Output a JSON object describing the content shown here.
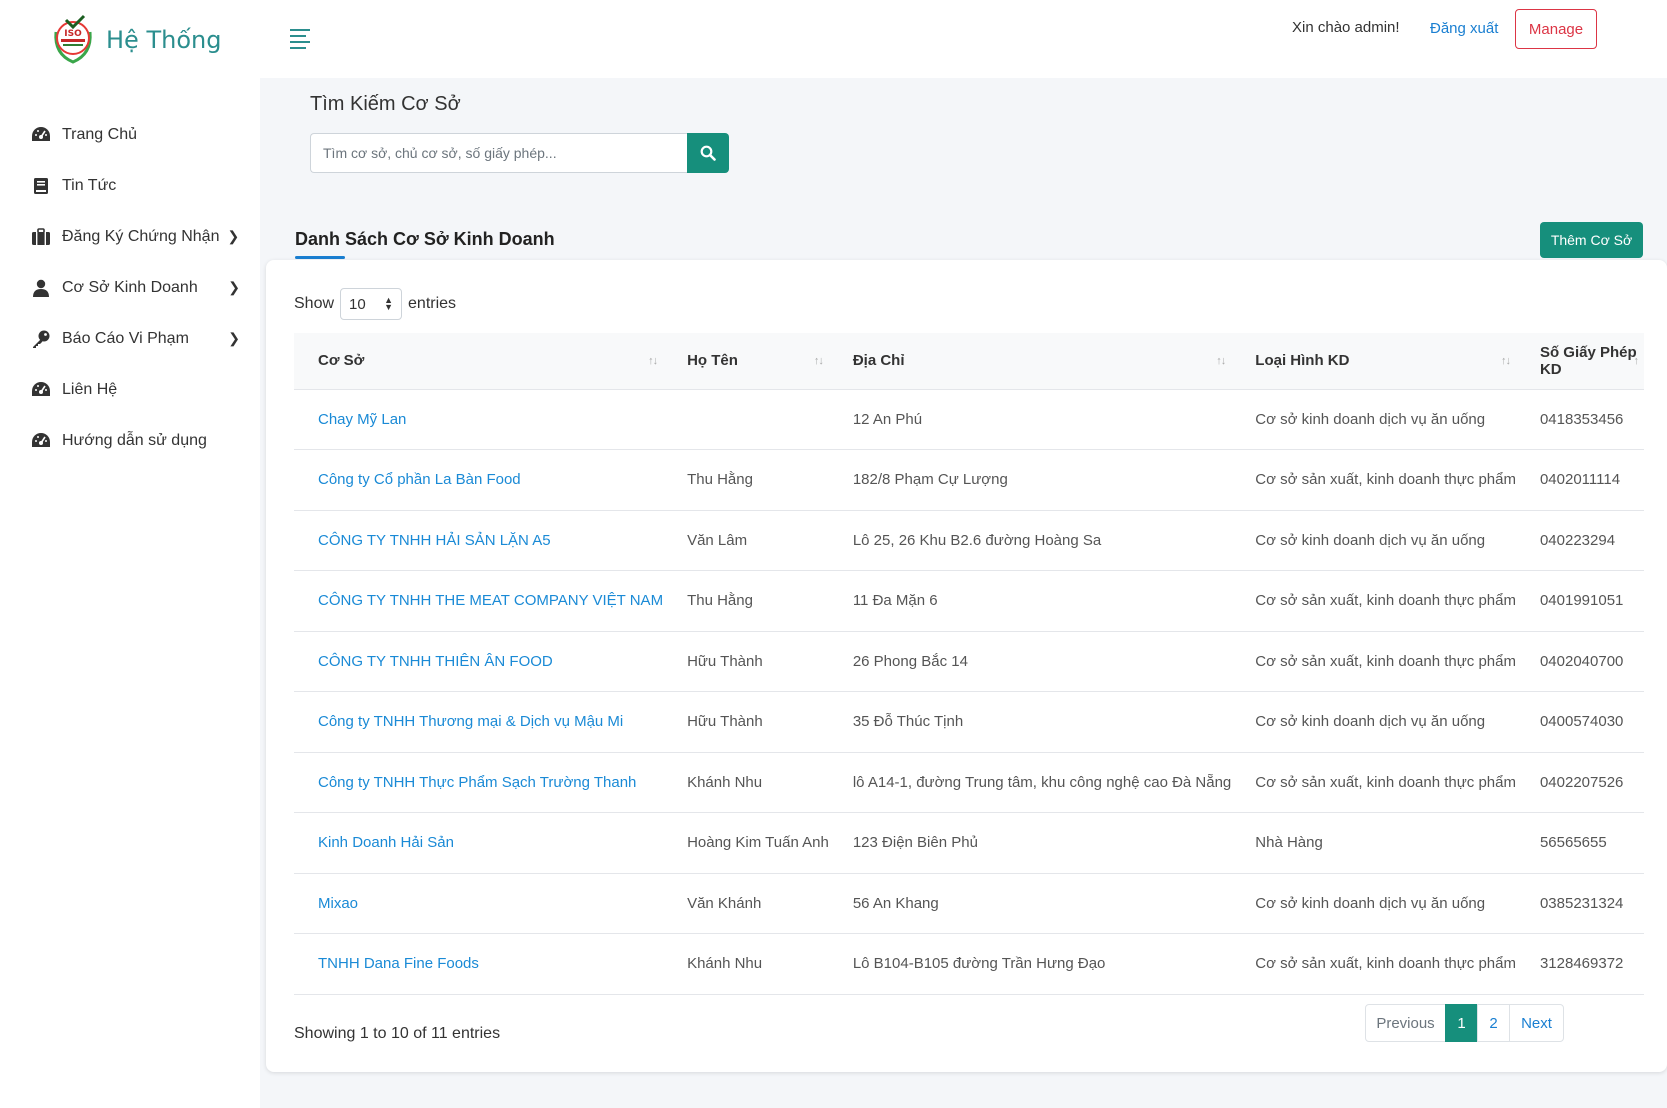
{
  "brand": {
    "title": "Hệ Thống",
    "logo_text": "ISO"
  },
  "sidebar": {
    "items": [
      {
        "label": "Trang Chủ",
        "icon": "dashboard-icon"
      },
      {
        "label": "Tin Tức",
        "icon": "book-icon"
      },
      {
        "label": "Đăng Ký Chứng Nhận",
        "icon": "briefcase-icon",
        "chevron": true
      },
      {
        "label": "Cơ Sở Kinh Doanh",
        "icon": "user-icon",
        "chevron": true
      },
      {
        "label": "Báo Cáo Vi Phạm",
        "icon": "key-icon",
        "chevron": true
      },
      {
        "label": "Liên Hệ",
        "icon": "dashboard-icon"
      },
      {
        "label": "Hướng dẫn sử dụng",
        "icon": "dashboard-icon"
      }
    ]
  },
  "header": {
    "greeting": "Xin chào admin!",
    "logout": "Đăng xuất",
    "manage": "Manage"
  },
  "search": {
    "title": "Tìm Kiếm Cơ Sở",
    "placeholder": "Tìm cơ sở, chủ cơ sở, số giấy phép..."
  },
  "list": {
    "title": "Danh Sách Cơ Sở Kinh Doanh",
    "add_button": "Thêm Cơ Sở"
  },
  "table": {
    "show_label": "Show",
    "entries_label": "entries",
    "page_size": "10",
    "columns": [
      "Cơ Sở",
      "Họ Tên",
      "Địa Chỉ",
      "Loại Hình KD",
      "Số Giấy Phép KD"
    ],
    "rows": [
      [
        "Chay Mỹ Lan",
        "",
        "12 An Phú",
        "Cơ sở kinh doanh dịch vụ ăn uống",
        "0418353456"
      ],
      [
        "Công ty Cổ phần La Bàn Food",
        "Thu Hằng",
        "182/8 Phạm Cự Lượng",
        "Cơ sở sản xuất, kinh doanh thực phẩm",
        "0402011114"
      ],
      [
        "CÔNG TY TNHH HẢI SẢN LẶN A5",
        "Văn Lâm",
        "Lô 25, 26 Khu B2.6 đường Hoàng Sa",
        "Cơ sở kinh doanh dịch vụ ăn uống",
        "040223294"
      ],
      [
        "CÔNG TY TNHH THE MEAT COMPANY VIỆT NAM",
        "Thu Hằng",
        "11 Đa Mặn 6",
        "Cơ sở sản xuất, kinh doanh thực phẩm",
        "0401991051"
      ],
      [
        "CÔNG TY TNHH THIÊN ÂN FOOD",
        "Hữu Thành",
        "26 Phong Bắc 14",
        "Cơ sở sản xuất, kinh doanh thực phẩm",
        "0402040700"
      ],
      [
        "Công ty TNHH Thương mại & Dịch vụ Mậu Mi",
        "Hữu Thành",
        "35 Đỗ Thúc Tịnh",
        "Cơ sở kinh doanh dịch vụ ăn uống",
        "0400574030"
      ],
      [
        "Công ty TNHH Thực Phẩm Sạch Trường Thanh",
        "Khánh Nhu",
        "lô A14-1, đường Trung tâm, khu công nghệ cao Đà Nẵng",
        "Cơ sở sản xuất, kinh doanh thực phẩm",
        "0402207526"
      ],
      [
        "Kinh Doanh Hải Sản",
        "Hoàng Kim Tuấn Anh",
        "123 Điện Biên Phủ",
        "Nhà Hàng",
        "56565655"
      ],
      [
        "Mixao",
        "Văn Khánh",
        "56 An Khang",
        "Cơ sở kinh doanh dịch vụ ăn uống",
        "0385231324"
      ],
      [
        "TNHH Dana Fine Foods",
        "Khánh Nhu",
        "Lô B104-B105 đường Trần Hưng Đạo",
        "Cơ sở sản xuất, kinh doanh thực phẩm",
        "3128469372"
      ]
    ],
    "info": "Showing 1 to 10 of 11 entries"
  },
  "pagination": {
    "previous": "Previous",
    "pages": [
      "1",
      "2"
    ],
    "next": "Next",
    "current": "1"
  },
  "colors": {
    "accent": "#168f7c",
    "link": "#1a8ad6",
    "danger": "#dc3545",
    "brand": "#2b8e8e"
  }
}
